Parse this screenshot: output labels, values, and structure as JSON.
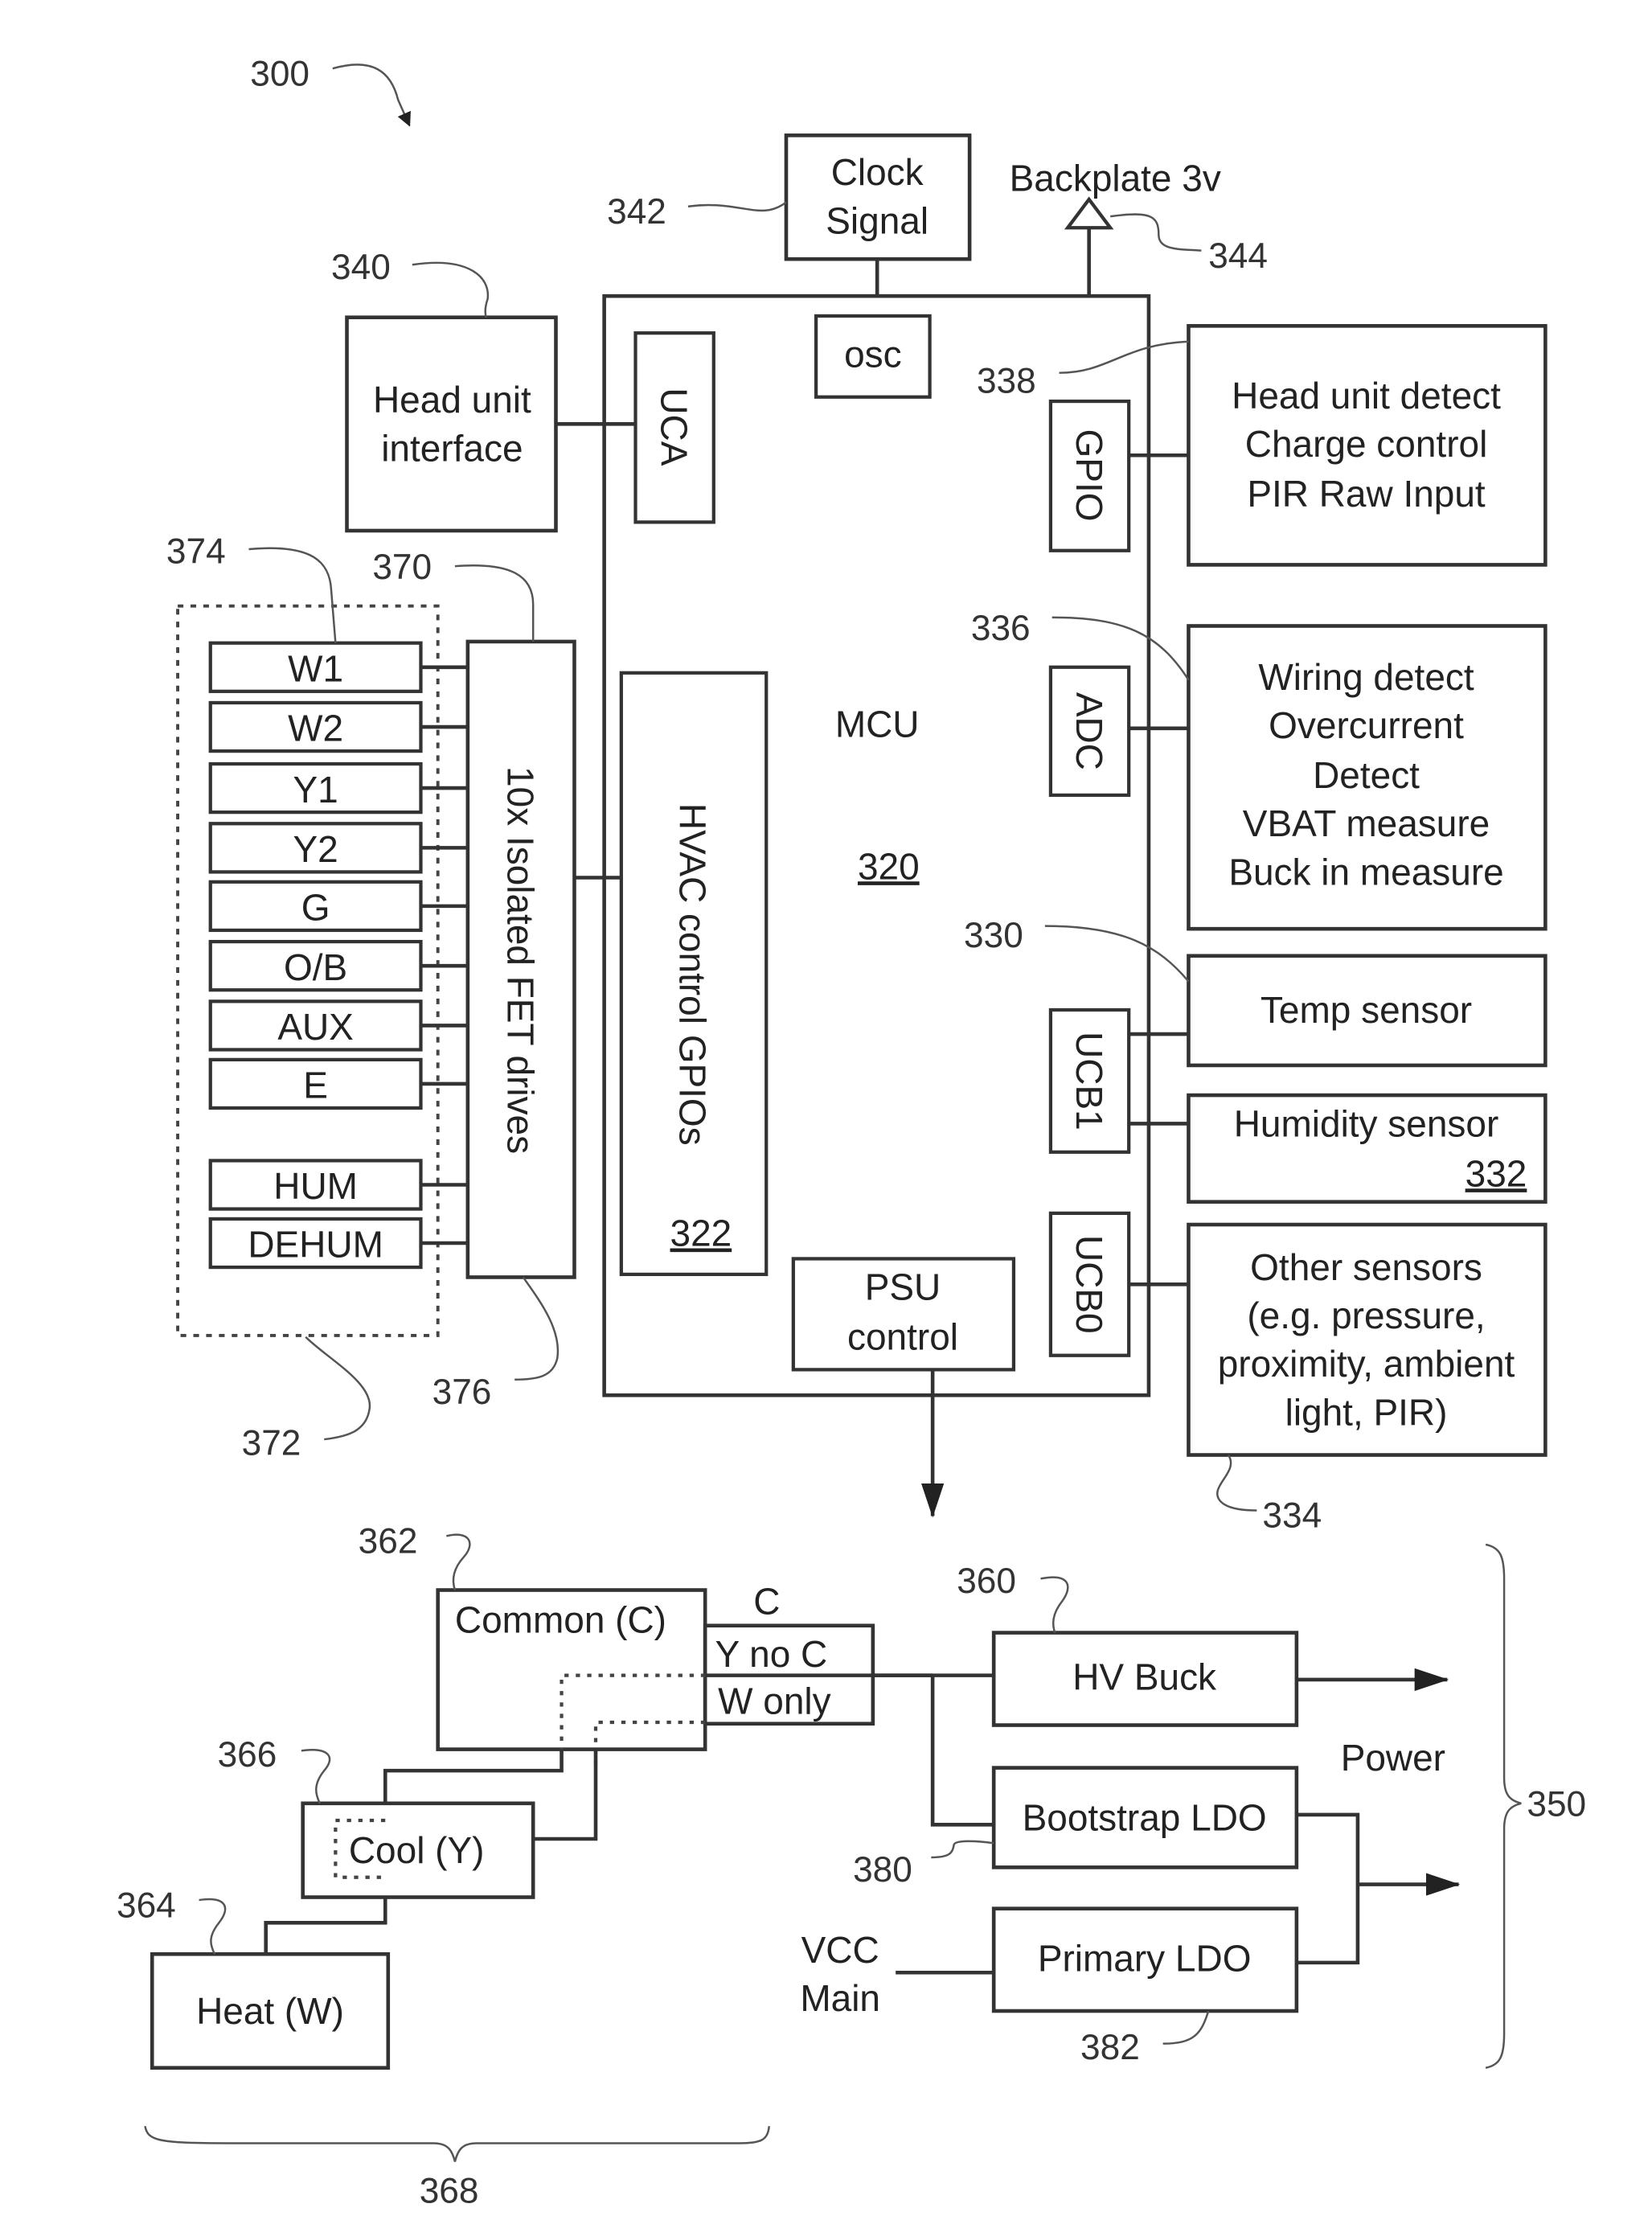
{
  "figure": {
    "ref_number": "300",
    "mcu": {
      "label": "MCU",
      "ref": "320"
    },
    "mcu_ports": {
      "uca": "UCA",
      "osc": "osc",
      "gpio": "GPIO",
      "adc": "ADC",
      "ucb1": "UCB1",
      "ucb0": "UCB0",
      "hvac_gpios": "HVAC control GPIOs",
      "hvac_gpios_ref": "322",
      "psu_control_line1": "PSU",
      "psu_control_line2": "control"
    },
    "clock": {
      "line1": "Clock",
      "line2": "Signal",
      "ref": "342"
    },
    "backplate": {
      "label": "Backplate 3v",
      "ref": "344"
    },
    "head_unit_interface": {
      "line1": "Head unit",
      "line2": "interface",
      "ref": "340"
    },
    "gpio_box": {
      "lines": [
        "Head unit detect",
        "Charge control",
        "PIR Raw Input"
      ],
      "ref": "338"
    },
    "adc_box": {
      "lines": [
        "Wiring detect",
        "Overcurrent",
        "Detect",
        "VBAT measure",
        "Buck in measure"
      ],
      "ref": "336"
    },
    "temp_sensor": {
      "label": "Temp sensor",
      "ref": "330"
    },
    "humidity_sensor": {
      "label": "Humidity sensor",
      "ref": "332"
    },
    "other_sensors": {
      "lines": [
        "Other sensors",
        "(e.g. pressure,",
        "proximity, ambient",
        "light, PIR)"
      ],
      "ref": "334"
    },
    "fet_drives": {
      "label": "10x Isolated FET drives",
      "ref": "370",
      "ref_bottom": "376"
    },
    "wire_terminals": {
      "ref_group": "372",
      "ref_terminal": "374",
      "items": [
        "W1",
        "W2",
        "Y1",
        "Y2",
        "G",
        "O/B",
        "AUX",
        "E",
        "HUM",
        "DEHUM"
      ]
    },
    "power": {
      "common": {
        "label": "Common (C)",
        "ref": "362"
      },
      "cool": {
        "label": "Cool (Y)",
        "ref": "366"
      },
      "heat": {
        "label": "Heat (W)",
        "ref": "364"
      },
      "hvac_group_ref": "368",
      "selector": {
        "c": "C",
        "y_no_c": "Y no C",
        "w_only": "W only"
      },
      "hv_buck": {
        "label": "HV Buck",
        "ref": "360"
      },
      "bootstrap_ldo": {
        "label": "Bootstrap LDO",
        "ref": "380"
      },
      "primary_ldo": {
        "label": "Primary LDO",
        "ref": "382"
      },
      "vcc_main": {
        "line1": "VCC",
        "line2": "Main"
      },
      "power_label": "Power",
      "power_group_ref": "350"
    }
  }
}
